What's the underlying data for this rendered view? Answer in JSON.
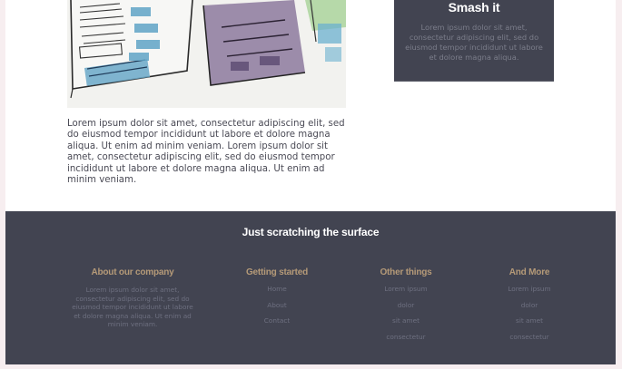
{
  "intro": {
    "paragraph": "Lorem ipsum dolor sit amet, consectetur adipiscing elit, sed do eiusmod tempor incididunt ut labore et dolore magna aliqua. Ut enim ad minim veniam. Lorem ipsum dolor sit amet, consectetur adipiscing elit, sed do eiusmod tempor incididunt ut labore et dolore magna aliqua. Ut enim ad minim veniam."
  },
  "promo": {
    "title": "Smash it",
    "text": "Lorem ipsum dolor sit amet, consectetur adipiscing elit, sed do eiusmod tempor incididunt ut labore et dolore magna aliqua."
  },
  "footer": {
    "title": "Just scratching the surface",
    "about": {
      "title": "About our company",
      "text": "Lorem ipsum dolor sit amet, consectetur adipiscing elit, sed do eiusmod tempor incididunt ut labore et dolore magna aliqua. Ut enim ad minim veniam."
    },
    "getting_started": {
      "title": "Getting started",
      "links": [
        "Home",
        "About",
        "Contact"
      ]
    },
    "other_things": {
      "title": "Other things",
      "items": [
        "Lorem ipsum",
        "dolor",
        "sit amet",
        "consectetur"
      ]
    },
    "and_more": {
      "title": "And More",
      "items": [
        "Lorem ipsum",
        "dolor",
        "sit amet",
        "consectetur"
      ]
    }
  },
  "colors": {
    "footer_bg": "#424451",
    "accent_gold": "#b59a78",
    "muted_text": "#6e7080",
    "page_bg": "#f7eef0"
  },
  "icons": {
    "hero_image": "wireframe-sketch-illustration"
  }
}
